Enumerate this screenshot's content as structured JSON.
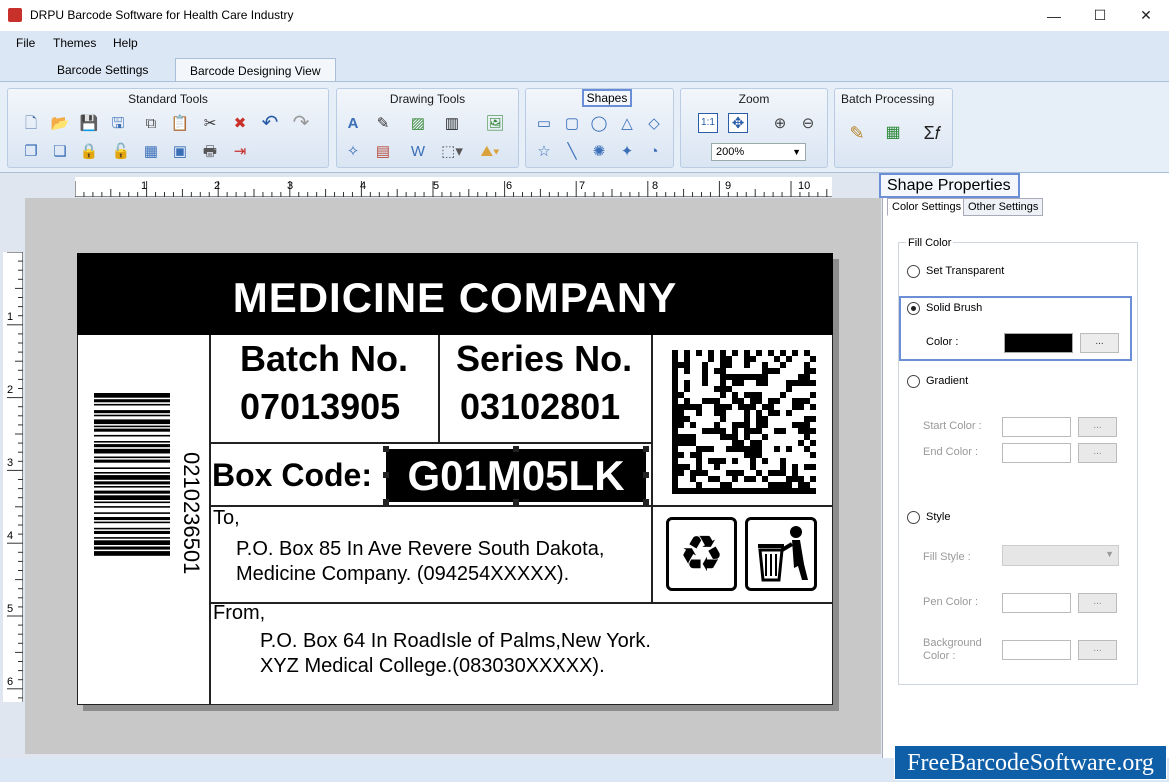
{
  "app": {
    "title": "DRPU Barcode Software for Health Care Industry"
  },
  "window": {
    "minimize": "—",
    "maximize": "☐",
    "close": "✕"
  },
  "menu": {
    "file": "File",
    "themes": "Themes",
    "help": "Help"
  },
  "tabs": {
    "settings": "Barcode Settings",
    "designing": "Barcode Designing View"
  },
  "ribbon": {
    "standard_tools": "Standard Tools",
    "drawing_tools": "Drawing Tools",
    "shapes": "Shapes",
    "zoom": "Zoom",
    "batch_processing": "Batch Processing",
    "zoom_value": "200%"
  },
  "ruler": {
    "h_ticks": [
      "1",
      "2",
      "3",
      "4",
      "5",
      "6",
      "7",
      "8",
      "9",
      "10"
    ],
    "v_ticks": [
      "1",
      "2",
      "3",
      "4",
      "5",
      "6"
    ]
  },
  "label": {
    "header": "MEDICINE COMPANY",
    "batch_title": "Batch No.",
    "batch_value": "07013905",
    "series_title": "Series No.",
    "series_value": "03102801",
    "box_code_label": "Box Code:",
    "box_code_value": "G01M05LK",
    "barcode_number": "0210236501",
    "to_label": "To,",
    "to_line1": "P.O. Box 85 In Ave Revere South Dakota,",
    "to_line2": "Medicine Company. (094254XXXXX).",
    "from_label": "From,",
    "from_line1": "P.O. Box 64 In RoadIsle of Palms,New York.",
    "from_line2": "XYZ Medical College.(083030XXXXX)."
  },
  "props": {
    "title": "Shape Properties",
    "tab_color": "Color Settings",
    "tab_other": "Other Settings",
    "fill_color": "Fill Color",
    "set_transparent": "Set Transparent",
    "solid_brush": "Solid Brush",
    "color": "Color :",
    "dots": "...",
    "gradient": "Gradient",
    "start_color": "Start Color :",
    "end_color": "End Color :",
    "style": "Style",
    "fill_style": "Fill Style :",
    "pen_color": "Pen Color :",
    "background_color": "Background\nColor :",
    "solid_color_hex": "#000000"
  },
  "brand": "FreeBarcodeSoftware.org"
}
